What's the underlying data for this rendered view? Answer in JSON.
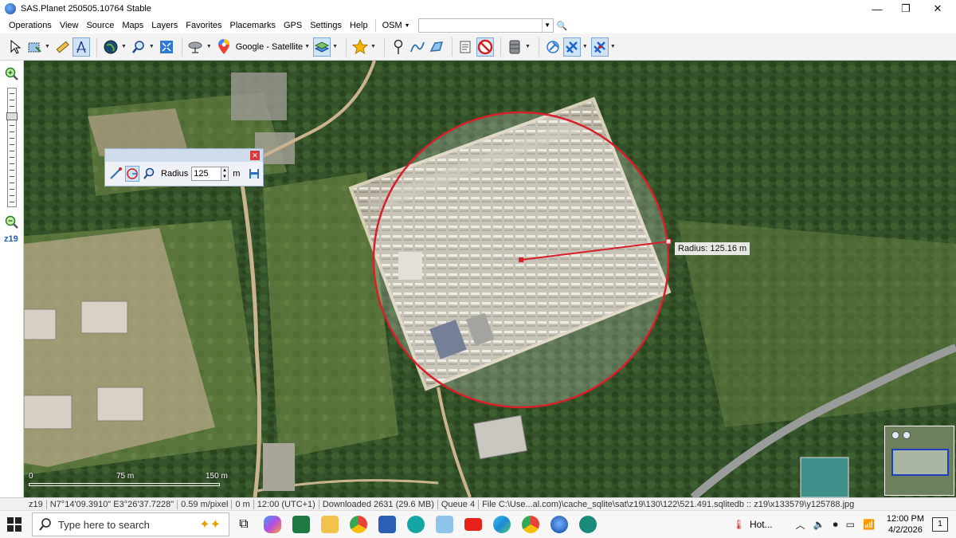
{
  "window": {
    "title": "SAS.Planet 250505.10764 Stable",
    "minimize_glyph": "—",
    "maximize_glyph": "❐",
    "close_glyph": "✕"
  },
  "menu": {
    "items": [
      "Operations",
      "View",
      "Source",
      "Maps",
      "Layers",
      "Favorites",
      "Placemarks",
      "GPS",
      "Settings",
      "Help"
    ],
    "search_provider": "OSM",
    "search_value": ""
  },
  "toolbar": {
    "map_source_label": "Google - Satellite"
  },
  "zoom": {
    "level_label": "z19"
  },
  "radius_tool": {
    "label": "Radius",
    "value": "125",
    "unit": "m"
  },
  "map": {
    "radius_readout": "Radius: 125.16 m",
    "scale_labels": [
      "0",
      "75 m",
      "150 m"
    ]
  },
  "status": {
    "zoom": "z19",
    "coordinates": "N7°14'09.3910\" E3°26'37.7228\"",
    "resolution": "0.59 m/pixel",
    "distance": "0 m",
    "time": "12:00 (UTC+1)",
    "downloaded": "Downloaded 2631 (29.6 MB)",
    "queue": "Queue 4",
    "file": "File C:\\Use...al.com)\\cache_sqlite\\sat\\z19\\130\\122\\521.491.sqlitedb :: z19\\x133579\\y125788.jpg"
  },
  "taskbar": {
    "search_placeholder": "Type here to search",
    "weather_text": "Hot...",
    "clock_time": "12:00 PM",
    "clock_date": "4/2/2026",
    "notification_count": "1"
  },
  "colors": {
    "radius_circle": "#d81f2a",
    "accent": "#1b5fbf",
    "vegetation_dark": "#2f4a22",
    "vegetation_light": "#5f7a3e",
    "bare_ground": "#b9a98c"
  }
}
